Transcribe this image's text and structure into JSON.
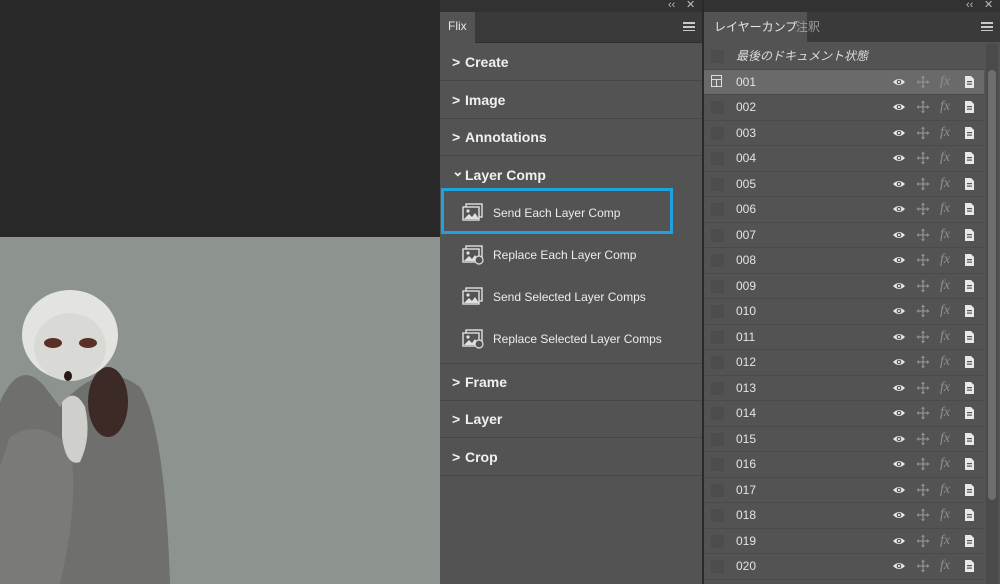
{
  "flix_panel": {
    "collapse_glyph": "‹‹",
    "close_glyph": "✕",
    "tab_label": "Flix",
    "sections": [
      {
        "label": "Create",
        "chevron": ">"
      },
      {
        "label": "Image",
        "chevron": ">"
      },
      {
        "label": "Annotations",
        "chevron": ">"
      },
      {
        "label": "Layer Comp",
        "chevron": "⌄"
      },
      {
        "label": "Frame",
        "chevron": ">"
      },
      {
        "label": "Layer",
        "chevron": ">"
      },
      {
        "label": "Crop",
        "chevron": ">"
      }
    ],
    "actions": [
      {
        "label": "Send Each Layer Comp",
        "icon": "image-send-icon"
      },
      {
        "label": "Replace Each Layer Comp",
        "icon": "image-replace-icon"
      },
      {
        "label": "Send Selected Layer Comps",
        "icon": "image-send-icon"
      },
      {
        "label": "Replace Selected Layer Comps",
        "icon": "image-replace-icon"
      }
    ],
    "highlight_color": "#1ea3de"
  },
  "comp_panel": {
    "collapse_glyph": "‹‹",
    "close_glyph": "✕",
    "tabs": [
      {
        "label": "レイヤーカンプ",
        "active": true
      },
      {
        "label": "注釈",
        "active": false
      }
    ],
    "last_document_state": "最後のドキュメント状態",
    "rows": [
      "001",
      "002",
      "003",
      "004",
      "005",
      "006",
      "007",
      "008",
      "009",
      "010",
      "011",
      "012",
      "013",
      "014",
      "015",
      "016",
      "017",
      "018",
      "019",
      "020"
    ],
    "selected_row": "001",
    "row_icons": [
      "eye-icon",
      "move-icon",
      "fx-icon",
      "appearance-icon"
    ],
    "fx_glyph": "fx"
  }
}
